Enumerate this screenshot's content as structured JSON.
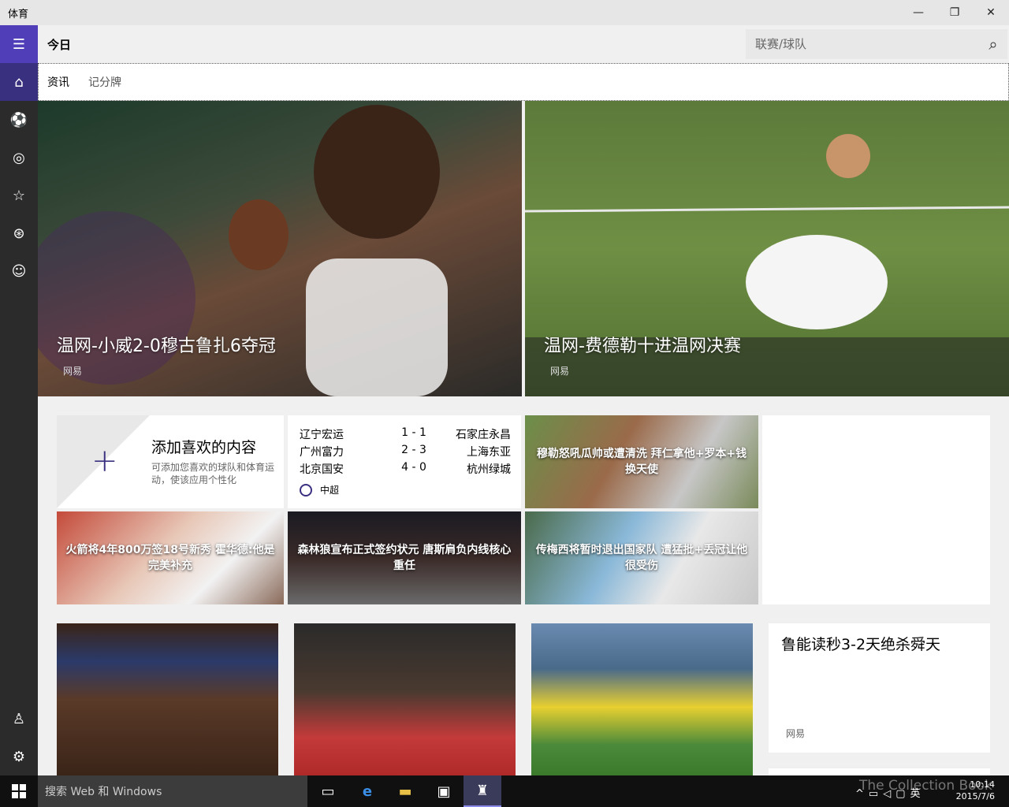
{
  "window": {
    "title": "体育",
    "minimize": "—",
    "maximize": "❐",
    "close": "✕"
  },
  "header": {
    "title": "今日",
    "search_placeholder": "联赛/球队"
  },
  "tabs": [
    {
      "label": "资讯"
    },
    {
      "label": "记分牌"
    }
  ],
  "heroes": [
    {
      "title": "温网-小威2-0穆古鲁扎6夺冠",
      "source": "网易"
    },
    {
      "title": "温网-费德勒十进温网决赛",
      "source": "网易"
    }
  ],
  "add_tile": {
    "title": "添加喜欢的内容",
    "desc": "可添加您喜欢的球队和体育运动，使该应用个性化"
  },
  "scoreboard": {
    "league": "中超",
    "matches": [
      {
        "home": "辽宁宏运",
        "score": "1 - 1",
        "away": "石家庄永昌"
      },
      {
        "home": "广州富力",
        "score": "2 - 3",
        "away": "上海东亚"
      },
      {
        "home": "北京国安",
        "score": "4 - 0",
        "away": "杭州绿城"
      }
    ]
  },
  "tiles": [
    {
      "caption": "穆勒怒吼瓜帅或遭清洗 拜仁拿他+罗本+钱换天使"
    },
    {
      "caption": "火箭将4年800万签18号新秀 霍华德:他是完美补充"
    },
    {
      "caption": "森林狼宣布正式签约状元 唐斯肩负内线核心重任"
    },
    {
      "caption": "传梅西将暂时退出国家队 遭猛批+丢冠让他很受伤"
    }
  ],
  "story": {
    "title": "鲁能读秒3-2天绝杀舜天",
    "source": "网易"
  },
  "taskbar": {
    "search_placeholder": "搜索 Web 和 Windows",
    "time": "10:14",
    "date": "2015/7/6",
    "ime": "英",
    "watermark": "The Collection Book"
  }
}
